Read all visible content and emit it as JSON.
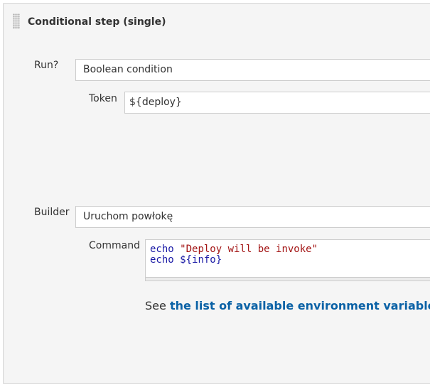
{
  "section": {
    "title": "Conditional step (single)"
  },
  "run": {
    "label": "Run?",
    "value": "Boolean condition",
    "token": {
      "label": "Token",
      "value": "${deploy}"
    }
  },
  "builder": {
    "label": "Builder",
    "value": "Uruchom powłokę",
    "command": {
      "label": "Command",
      "lines": [
        {
          "kw": "echo",
          "arg": "\"Deploy will be invoke\"",
          "arg_type": "string"
        },
        {
          "kw": "echo",
          "arg": "${info}",
          "arg_type": "variable"
        }
      ]
    }
  },
  "env_hint": {
    "prefix": "See ",
    "link": "the list of available environment variables"
  },
  "colors": {
    "panel_bg": "#f5f5f5",
    "link": "#0b62a6",
    "code_keyword": "#1a1aa6",
    "code_string": "#a31515"
  },
  "icons": {
    "drag_handle": "grip-dots-icon"
  }
}
